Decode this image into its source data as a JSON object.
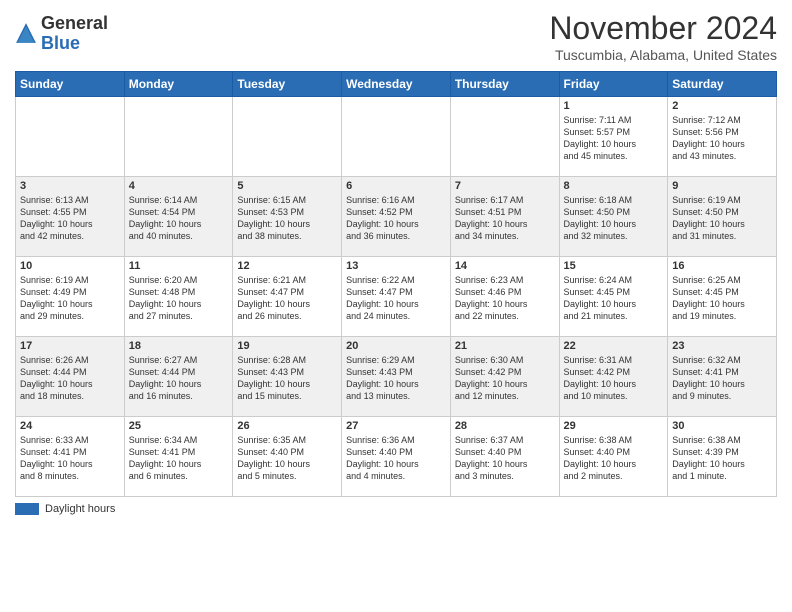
{
  "header": {
    "logo_general": "General",
    "logo_blue": "Blue",
    "month_title": "November 2024",
    "location": "Tuscumbia, Alabama, United States"
  },
  "days_of_week": [
    "Sunday",
    "Monday",
    "Tuesday",
    "Wednesday",
    "Thursday",
    "Friday",
    "Saturday"
  ],
  "weeks": [
    {
      "days": [
        {
          "num": "",
          "info": ""
        },
        {
          "num": "",
          "info": ""
        },
        {
          "num": "",
          "info": ""
        },
        {
          "num": "",
          "info": ""
        },
        {
          "num": "",
          "info": ""
        },
        {
          "num": "1",
          "info": "Sunrise: 7:11 AM\nSunset: 5:57 PM\nDaylight: 10 hours\nand 45 minutes."
        },
        {
          "num": "2",
          "info": "Sunrise: 7:12 AM\nSunset: 5:56 PM\nDaylight: 10 hours\nand 43 minutes."
        }
      ]
    },
    {
      "days": [
        {
          "num": "3",
          "info": "Sunrise: 6:13 AM\nSunset: 4:55 PM\nDaylight: 10 hours\nand 42 minutes."
        },
        {
          "num": "4",
          "info": "Sunrise: 6:14 AM\nSunset: 4:54 PM\nDaylight: 10 hours\nand 40 minutes."
        },
        {
          "num": "5",
          "info": "Sunrise: 6:15 AM\nSunset: 4:53 PM\nDaylight: 10 hours\nand 38 minutes."
        },
        {
          "num": "6",
          "info": "Sunrise: 6:16 AM\nSunset: 4:52 PM\nDaylight: 10 hours\nand 36 minutes."
        },
        {
          "num": "7",
          "info": "Sunrise: 6:17 AM\nSunset: 4:51 PM\nDaylight: 10 hours\nand 34 minutes."
        },
        {
          "num": "8",
          "info": "Sunrise: 6:18 AM\nSunset: 4:50 PM\nDaylight: 10 hours\nand 32 minutes."
        },
        {
          "num": "9",
          "info": "Sunrise: 6:19 AM\nSunset: 4:50 PM\nDaylight: 10 hours\nand 31 minutes."
        }
      ]
    },
    {
      "days": [
        {
          "num": "10",
          "info": "Sunrise: 6:19 AM\nSunset: 4:49 PM\nDaylight: 10 hours\nand 29 minutes."
        },
        {
          "num": "11",
          "info": "Sunrise: 6:20 AM\nSunset: 4:48 PM\nDaylight: 10 hours\nand 27 minutes."
        },
        {
          "num": "12",
          "info": "Sunrise: 6:21 AM\nSunset: 4:47 PM\nDaylight: 10 hours\nand 26 minutes."
        },
        {
          "num": "13",
          "info": "Sunrise: 6:22 AM\nSunset: 4:47 PM\nDaylight: 10 hours\nand 24 minutes."
        },
        {
          "num": "14",
          "info": "Sunrise: 6:23 AM\nSunset: 4:46 PM\nDaylight: 10 hours\nand 22 minutes."
        },
        {
          "num": "15",
          "info": "Sunrise: 6:24 AM\nSunset: 4:45 PM\nDaylight: 10 hours\nand 21 minutes."
        },
        {
          "num": "16",
          "info": "Sunrise: 6:25 AM\nSunset: 4:45 PM\nDaylight: 10 hours\nand 19 minutes."
        }
      ]
    },
    {
      "days": [
        {
          "num": "17",
          "info": "Sunrise: 6:26 AM\nSunset: 4:44 PM\nDaylight: 10 hours\nand 18 minutes."
        },
        {
          "num": "18",
          "info": "Sunrise: 6:27 AM\nSunset: 4:44 PM\nDaylight: 10 hours\nand 16 minutes."
        },
        {
          "num": "19",
          "info": "Sunrise: 6:28 AM\nSunset: 4:43 PM\nDaylight: 10 hours\nand 15 minutes."
        },
        {
          "num": "20",
          "info": "Sunrise: 6:29 AM\nSunset: 4:43 PM\nDaylight: 10 hours\nand 13 minutes."
        },
        {
          "num": "21",
          "info": "Sunrise: 6:30 AM\nSunset: 4:42 PM\nDaylight: 10 hours\nand 12 minutes."
        },
        {
          "num": "22",
          "info": "Sunrise: 6:31 AM\nSunset: 4:42 PM\nDaylight: 10 hours\nand 10 minutes."
        },
        {
          "num": "23",
          "info": "Sunrise: 6:32 AM\nSunset: 4:41 PM\nDaylight: 10 hours\nand 9 minutes."
        }
      ]
    },
    {
      "days": [
        {
          "num": "24",
          "info": "Sunrise: 6:33 AM\nSunset: 4:41 PM\nDaylight: 10 hours\nand 8 minutes."
        },
        {
          "num": "25",
          "info": "Sunrise: 6:34 AM\nSunset: 4:41 PM\nDaylight: 10 hours\nand 6 minutes."
        },
        {
          "num": "26",
          "info": "Sunrise: 6:35 AM\nSunset: 4:40 PM\nDaylight: 10 hours\nand 5 minutes."
        },
        {
          "num": "27",
          "info": "Sunrise: 6:36 AM\nSunset: 4:40 PM\nDaylight: 10 hours\nand 4 minutes."
        },
        {
          "num": "28",
          "info": "Sunrise: 6:37 AM\nSunset: 4:40 PM\nDaylight: 10 hours\nand 3 minutes."
        },
        {
          "num": "29",
          "info": "Sunrise: 6:38 AM\nSunset: 4:40 PM\nDaylight: 10 hours\nand 2 minutes."
        },
        {
          "num": "30",
          "info": "Sunrise: 6:38 AM\nSunset: 4:39 PM\nDaylight: 10 hours\nand 1 minute."
        }
      ]
    }
  ],
  "legend": {
    "daylight_label": "Daylight hours"
  }
}
